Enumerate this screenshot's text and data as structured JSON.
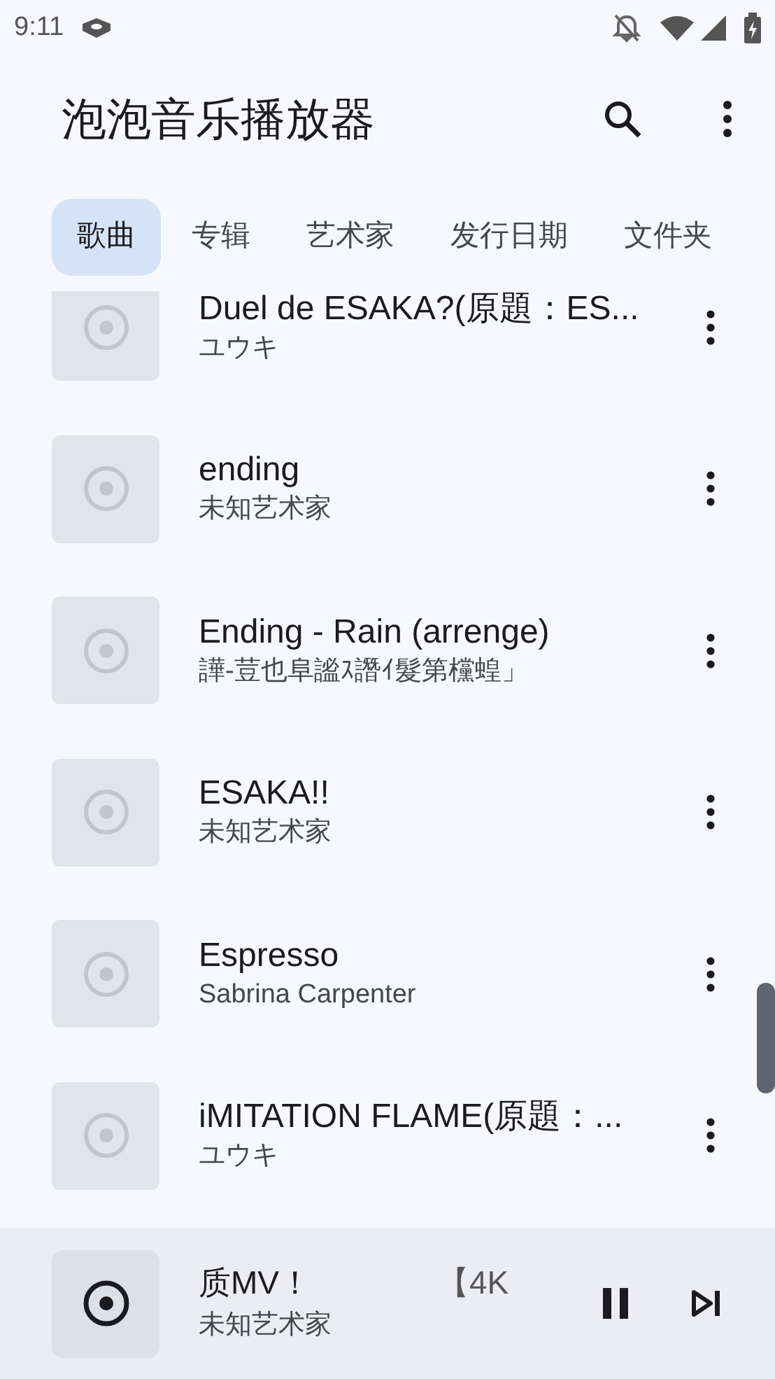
{
  "status_bar": {
    "time": "9:11"
  },
  "app_bar": {
    "title": "泡泡音乐播放器"
  },
  "tabs": [
    {
      "label": "歌曲",
      "selected": true
    },
    {
      "label": "专辑",
      "selected": false
    },
    {
      "label": "艺术家",
      "selected": false
    },
    {
      "label": "发行日期",
      "selected": false
    },
    {
      "label": "文件夹",
      "selected": false
    }
  ],
  "songs": [
    {
      "title": "Duel de ESAKA?(原題：ES...",
      "artist": "ユウキ"
    },
    {
      "title": "ending",
      "artist": "未知艺术家"
    },
    {
      "title": "Ending - Rain (arrenge)",
      "artist": "譁-荳也阜謐ｽ譖ｲ髮第欓蝗」"
    },
    {
      "title": "ESAKA!!",
      "artist": "未知艺术家"
    },
    {
      "title": "Espresso",
      "artist": "Sabrina Carpenter"
    },
    {
      "title": "iMITATION FLAME(原題：...",
      "artist": "ユウキ"
    }
  ],
  "now_playing": {
    "title_parts": [
      "质MV！",
      "【4K"
    ],
    "artist": "未知艺术家",
    "playing": true
  }
}
